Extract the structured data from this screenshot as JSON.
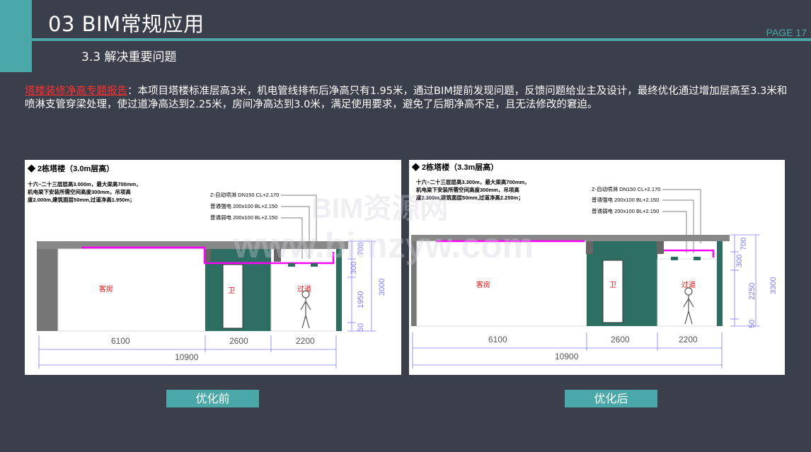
{
  "header": {
    "title": "03  BIM常规应用",
    "page_label": "PAGE 17",
    "subtitle": "3.3  解决重要问题"
  },
  "description": {
    "highlight": "塔楼装修净高专题报告",
    "text": "：本项目塔楼标准层高3米，机电管线排布后净高只有1.95米，通过BIM提前发现问题，反馈问题给业主及设计，最终优化通过增加层高至3.3米和喷淋支管穿梁处理，使过道净高达到2.25米，房间净高达到3.0米，满足使用要求，避免了后期净高不足，且无法修改的窘迫。"
  },
  "panels": {
    "before": {
      "heading": "◆ 2栋塔楼（3.0m层高）",
      "note_lines": [
        "十六~二十三层层高3.000m，最大梁高700mm，",
        "机电梁下安装所需空间高度300mm，吊项高",
        "度2.000m,建筑面层50mm,过道净高1.950m；"
      ],
      "legend": [
        "Z-自动喷淋 DN150 CL+2.170",
        "普通强电 200x100 BL+2.150",
        "普通弱电 200x100 BL+2.150"
      ],
      "room_labels": {
        "guest": "客房",
        "bath": "卫",
        "corridor": "过道"
      },
      "vertical_dims": [
        "700",
        "300",
        "1950",
        "50",
        "3000"
      ],
      "horizontal_dims": [
        "6100",
        "2600",
        "2200",
        "10900"
      ],
      "caption": "优化前"
    },
    "after": {
      "heading": "◆ 2栋塔楼（3.3m层高）",
      "note_lines": [
        "十六~二十三层层高3.300m，最大梁高700mm，",
        "机电梁下安装所需空间高度300mm，吊项高",
        "度2.300m,建筑面层50mm,过道净高2.250m；"
      ],
      "legend": [
        "Z-自动喷淋 DN150 CL+2.170",
        "普通强电 200x100 BL+2.150",
        "普通弱电 200x100 BL+2.150"
      ],
      "room_labels": {
        "guest": "客房",
        "bath": "卫",
        "corridor": "过道"
      },
      "vertical_dims": [
        "700",
        "300",
        "2250",
        "50",
        "3300"
      ],
      "horizontal_dims": [
        "6100",
        "2600",
        "2200",
        "10900"
      ],
      "caption": "优化后"
    }
  },
  "watermark": {
    "line1": "BIM资源网",
    "line2": "www.bimzyw.com"
  },
  "colors": {
    "accent": "#4aa8a8",
    "background": "#3b3f4c",
    "highlight": "#ff3030",
    "pipe": "#ff00ff",
    "wall": "#2e6e62",
    "dim": "#7b7bff"
  }
}
